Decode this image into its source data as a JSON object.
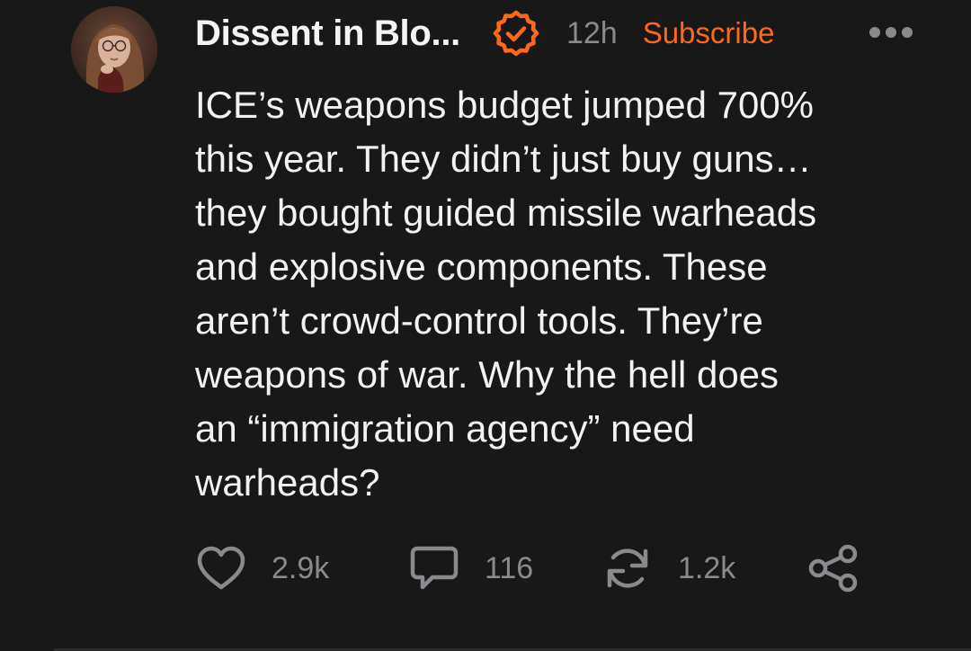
{
  "post": {
    "author": "Dissent in Blo...",
    "time_ago": "12h",
    "subscribe_label": "Subscribe",
    "body": "ICE’s weapons budget jumped 700%\nthis year. They didn’t just buy guns…\nthey bought guided missile warheads\nand explosive components. These\naren’t crowd-control tools. They’re\nweapons of war. Why the hell does\nan “immigration agency” need\nwarheads?",
    "actions": {
      "likes": "2.9k",
      "comments": "116",
      "restacks": "1.2k"
    }
  },
  "colors": {
    "background": "#181819",
    "accent": "#ff6719",
    "muted": "#8a8a8e",
    "text": "#f2f2f3"
  },
  "icons": [
    "verified-badge-icon",
    "more-options-icon",
    "heart-icon",
    "comment-icon",
    "restack-icon",
    "share-icon"
  ]
}
